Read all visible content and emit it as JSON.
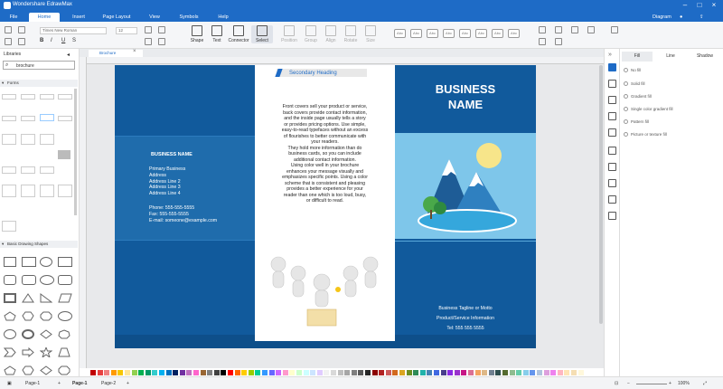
{
  "app": {
    "title": "Wondershare EdrawMax"
  },
  "menu": {
    "tabs": [
      "File",
      "Home",
      "Insert",
      "Page Layout",
      "View",
      "Symbols",
      "Help"
    ],
    "active": "Home",
    "diagram_label": "Diagram"
  },
  "ribbon": {
    "font_name": "Times New Roman",
    "font_size": "12",
    "tools": [
      "Shape",
      "Text",
      "Connector",
      "Select"
    ],
    "dim_tools": [
      "Position",
      "Group",
      "Align",
      "Rotate",
      "Size"
    ],
    "style_label": "Abc"
  },
  "library": {
    "title": "Libraries",
    "search_value": "brochure",
    "sections": [
      "Forms",
      "Basic Drawing Shapes"
    ]
  },
  "document": {
    "tab_name": "Brochure"
  },
  "brochure": {
    "left_panel": {
      "business_name": "BUSINESS NAME",
      "address_lines": [
        "Primary Business",
        "Address",
        "Address Line 2",
        "Address Line 3",
        "Address Line 4"
      ],
      "contact_lines": [
        "Phone: 555-555-5555",
        "Fax: 555-555-5555",
        "E-mail: someone@example.com"
      ]
    },
    "middle_panel": {
      "heading": "Secondary Heading",
      "body_lines": [
        "Front covers sell your product or service,",
        "back covers provide contact information,",
        "and the inside page usually tells a story",
        "or provides pricing options. Use simple,",
        "easy-to-read typefaces without an excess",
        "of flourishes to better communicate with",
        "your readers.",
        "They hold more information than do",
        "business cards, so you can include",
        "additional contact information.",
        "Using color well in your brochure",
        "enhances your message visually and",
        "emphasizes specific points. Using a color",
        "scheme that is consistent and pleasing",
        "provides a better experience for your",
        "reader than one which is too loud, busy,",
        "or difficult to read."
      ]
    },
    "right_panel": {
      "title_line1": "BUSINESS",
      "title_line2": "NAME",
      "tagline": "Business Tagline or Motto",
      "product": "Product/Service Information",
      "tel": "Tel: 555 555 5555"
    }
  },
  "format_panel": {
    "tabs": [
      "Fill",
      "Line",
      "Shadow"
    ],
    "active_tab": "Fill",
    "options": [
      "No fill",
      "Solid fill",
      "Gradient fill",
      "Single color gradient fill",
      "Pattern fill",
      "Picture or texture fill"
    ]
  },
  "status": {
    "pages": [
      "Page-1",
      "Page-1",
      "Page-2"
    ],
    "zoom": "100%"
  },
  "colors": {
    "brand": "#1e6bc6",
    "page_blue": "#115a9c",
    "sky": "#7ec6ea"
  }
}
